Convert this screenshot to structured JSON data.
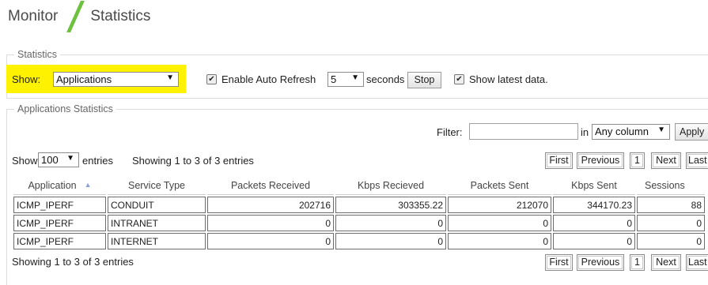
{
  "breadcrumb": {
    "section": "Monitor",
    "page": "Statistics"
  },
  "stats_panel": {
    "legend": "Statistics",
    "show_label": "Show:",
    "show_value": "Applications",
    "auto_refresh_label": "Enable Auto Refresh",
    "auto_refresh_checked": true,
    "seconds_value": "5",
    "seconds_label": "seconds",
    "stop_label": "Stop",
    "latest_label": "Show latest data.",
    "latest_checked": true,
    "highlight_color": "#fff200"
  },
  "app_stats": {
    "legend": "Applications Statistics",
    "filter_label": "Filter:",
    "filter_value": "",
    "in_label": "in",
    "column_value": "Any column",
    "apply_label": "Apply",
    "show_label": "Show",
    "page_size": "100",
    "entries_label": "entries",
    "info_top": "Showing 1 to 3 of 3 entries",
    "info_bottom": "Showing 1 to 3 of 3 entries",
    "pager": {
      "first": "First",
      "previous": "Previous",
      "page": "1",
      "next": "Next",
      "last": "Last"
    },
    "columns": [
      "Application",
      "Service Type",
      "Packets Received",
      "Kbps Recieved",
      "Packets Sent",
      "Kbps Sent",
      "Sessions"
    ],
    "rows": [
      [
        "ICMP_IPERF",
        "CONDUIT",
        "202716",
        "303355.22",
        "212070",
        "344170.23",
        "88"
      ],
      [
        "ICMP_IPERF",
        "INTRANET",
        "0",
        "0",
        "0",
        "0",
        "0"
      ],
      [
        "ICMP_IPERF",
        "INTERNET",
        "0",
        "0",
        "0",
        "0",
        "0"
      ]
    ]
  },
  "icons": {
    "dropdown": "chevron-down-icon",
    "checkbox": "checkmark-icon",
    "sort": "sort-ascending-icon"
  }
}
